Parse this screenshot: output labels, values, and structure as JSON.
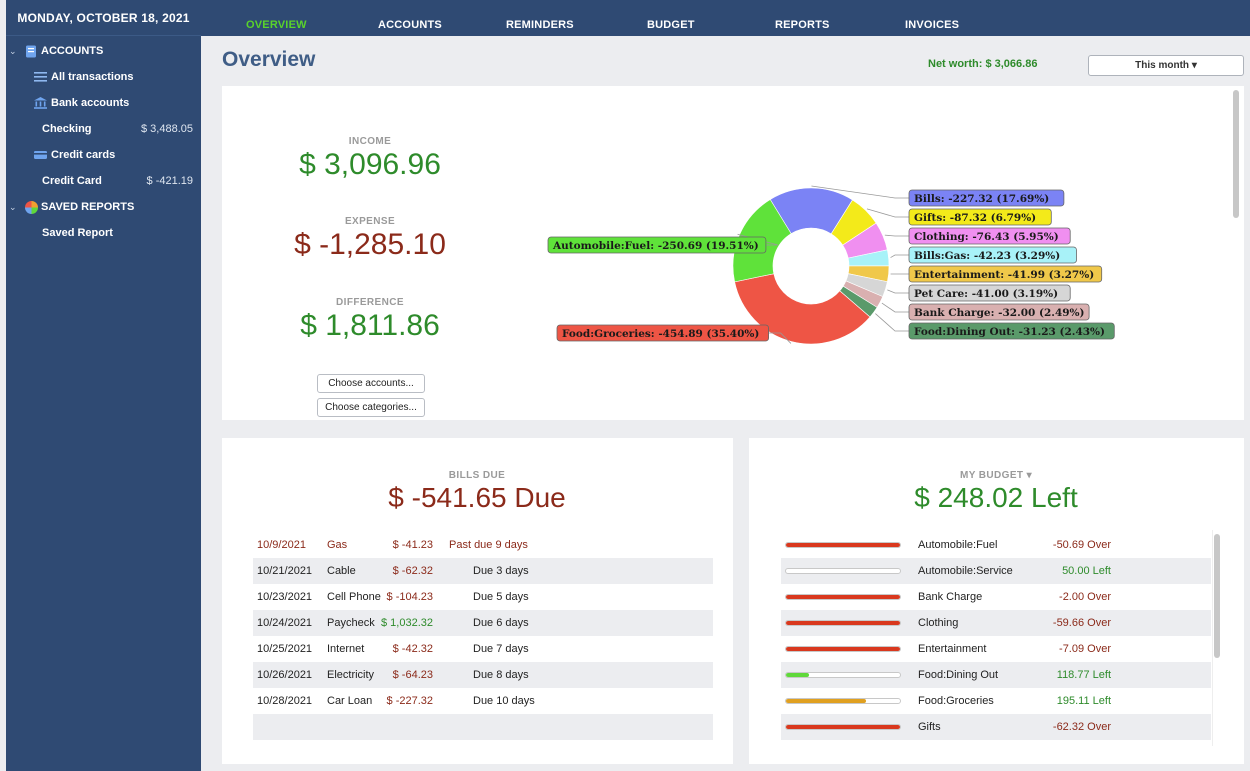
{
  "sidebar": {
    "date": "MONDAY, OCTOBER 18, 2021",
    "accounts_header": "ACCOUNTS",
    "all_transactions": "All transactions",
    "bank_accounts": "Bank accounts",
    "checking": {
      "label": "Checking",
      "amount": "$ 3,488.05"
    },
    "credit_cards": "Credit cards",
    "credit_card": {
      "label": "Credit Card",
      "amount": "$ -421.19"
    },
    "saved_reports_header": "SAVED REPORTS",
    "saved_report": "Saved Report"
  },
  "nav": {
    "overview": "OVERVIEW",
    "accounts": "ACCOUNTS",
    "reminders": "REMINDERS",
    "budget": "BUDGET",
    "reports": "REPORTS",
    "invoices": "INVOICES"
  },
  "header": {
    "title": "Overview",
    "net_worth": "Net worth: $ 3,066.86",
    "period": "This month ▾"
  },
  "summary": {
    "income_label": "INCOME",
    "income_value": "$ 3,096.96",
    "expense_label": "EXPENSE",
    "expense_value": "$ -1,285.10",
    "difference_label": "DIFFERENCE",
    "difference_value": "$ 1,811.86",
    "choose_accounts": "Choose accounts...",
    "choose_categories": "Choose categories..."
  },
  "chart_data": {
    "type": "pie",
    "donut": true,
    "slices": [
      {
        "label": "Bills: -227.32 (17.69%)",
        "value": 17.69,
        "color": "#7b83f5"
      },
      {
        "label": "Gifts: -87.32 (6.79%)",
        "value": 6.79,
        "color": "#f3ea1a"
      },
      {
        "label": "Clothing: -76.43 (5.95%)",
        "value": 5.95,
        "color": "#f08ff0"
      },
      {
        "label": "Bills:Gas: -42.23 (3.29%)",
        "value": 3.29,
        "color": "#a8f2f8"
      },
      {
        "label": "Entertainment: -41.99 (3.27%)",
        "value": 3.27,
        "color": "#f0c84a"
      },
      {
        "label": "Pet Care: -41.00 (3.19%)",
        "value": 3.19,
        "color": "#d6d6d6"
      },
      {
        "label": "Bank Charge: -32.00 (2.49%)",
        "value": 2.49,
        "color": "#d9b0b0"
      },
      {
        "label": "Food:Dining Out: -31.23 (2.43%)",
        "value": 2.43,
        "color": "#5a9a6a"
      },
      {
        "label": "Food:Groceries: -454.89 (35.40%)",
        "value": 35.4,
        "color": "#ee5545"
      },
      {
        "label": "Automobile:Fuel: -250.69 (19.51%)",
        "value": 19.51,
        "color": "#5fe23a"
      }
    ]
  },
  "bills": {
    "label": "BILLS DUE",
    "total": "$ -541.65 Due",
    "rows": [
      {
        "date": "10/9/2021",
        "name": "Gas",
        "amount": "$ -41.23",
        "status": "Past due 9 days",
        "overdue": true
      },
      {
        "date": "10/21/2021",
        "name": "Cable",
        "amount": "$ -62.32",
        "status": "Due 3 days"
      },
      {
        "date": "10/23/2021",
        "name": "Cell Phone",
        "amount": "$ -104.23",
        "status": "Due 5 days"
      },
      {
        "date": "10/24/2021",
        "name": "Paycheck",
        "amount": "$ 1,032.32",
        "status": "Due 6 days",
        "income": true
      },
      {
        "date": "10/25/2021",
        "name": "Internet",
        "amount": "$ -42.32",
        "status": "Due 7 days"
      },
      {
        "date": "10/26/2021",
        "name": "Electricity",
        "amount": "$ -64.23",
        "status": "Due 8 days"
      },
      {
        "date": "10/28/2021",
        "name": "Car Loan",
        "amount": "$ -227.32",
        "status": "Due 10 days"
      }
    ]
  },
  "budget": {
    "label": "MY BUDGET ▾",
    "total": "$ 248.02 Left",
    "rows": [
      {
        "category": "Automobile:Fuel",
        "status": "-50.69 Over",
        "over": true,
        "fill": 1.0,
        "color": "#d9381e"
      },
      {
        "category": "Automobile:Service",
        "status": "50.00 Left",
        "over": false,
        "fill": 0.0,
        "color": "#5fd83a"
      },
      {
        "category": "Bank Charge",
        "status": "-2.00 Over",
        "over": true,
        "fill": 1.0,
        "color": "#d9381e"
      },
      {
        "category": "Clothing",
        "status": "-59.66 Over",
        "over": true,
        "fill": 1.0,
        "color": "#d9381e"
      },
      {
        "category": "Entertainment",
        "status": "-7.09 Over",
        "over": true,
        "fill": 1.0,
        "color": "#d9381e"
      },
      {
        "category": "Food:Dining Out",
        "status": "118.77 Left",
        "over": false,
        "fill": 0.2,
        "color": "#5fd83a"
      },
      {
        "category": "Food:Groceries",
        "status": "195.11 Left",
        "over": false,
        "fill": 0.7,
        "color": "#e0a020"
      },
      {
        "category": "Gifts",
        "status": "-62.32 Over",
        "over": true,
        "fill": 1.0,
        "color": "#d9381e"
      }
    ]
  }
}
